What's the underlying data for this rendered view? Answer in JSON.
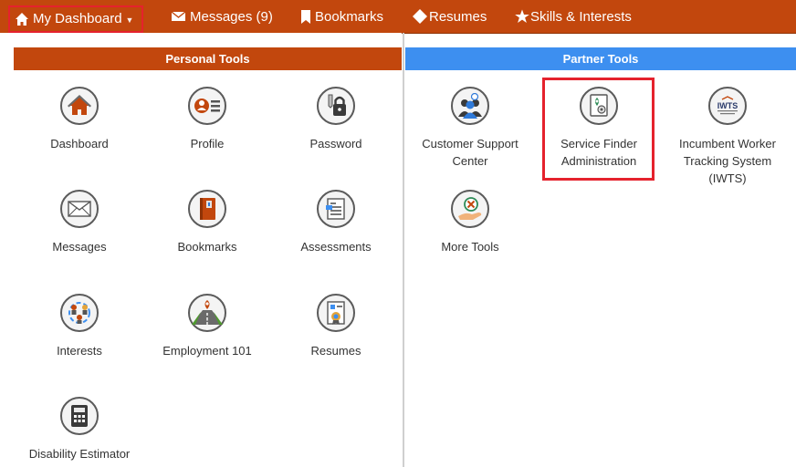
{
  "nav": {
    "dashboard": "My Dashboard",
    "messages": "Messages (9)",
    "bookmarks": "Bookmarks",
    "resumes": "Resumes",
    "skills": "Skills & Interests"
  },
  "personal": {
    "header": "Personal Tools",
    "tools": [
      {
        "label": "Dashboard",
        "icon": "home-icon"
      },
      {
        "label": "Profile",
        "icon": "profile-card-icon"
      },
      {
        "label": "Password",
        "icon": "padlock-key-icon"
      },
      {
        "label": "Messages",
        "icon": "envelope-icon"
      },
      {
        "label": "Bookmarks",
        "icon": "bookmark-book-icon"
      },
      {
        "label": "Assessments",
        "icon": "assessment-document-icon"
      },
      {
        "label": "Interests",
        "icon": "interests-people-icon"
      },
      {
        "label": "Employment 101",
        "icon": "road-pin-icon"
      },
      {
        "label": "Resumes",
        "icon": "resume-document-icon"
      },
      {
        "label": "Disability Estimator",
        "icon": "calculator-icon"
      }
    ]
  },
  "partner": {
    "header": "Partner Tools",
    "tools": [
      {
        "label": "Customer Support Center",
        "icon": "support-people-icon"
      },
      {
        "label": "Service Finder Administration",
        "icon": "service-finder-icon"
      },
      {
        "label": "Incumbent Worker Tracking System (IWTS)",
        "icon": "iwts-logo-icon",
        "logo_text": "IWTS"
      },
      {
        "label": "More Tools",
        "icon": "hand-tools-icon"
      }
    ]
  },
  "colors": {
    "nav_bg": "#c2470d",
    "partner_bg": "#3d8ff0",
    "highlight": "#e5222d"
  }
}
